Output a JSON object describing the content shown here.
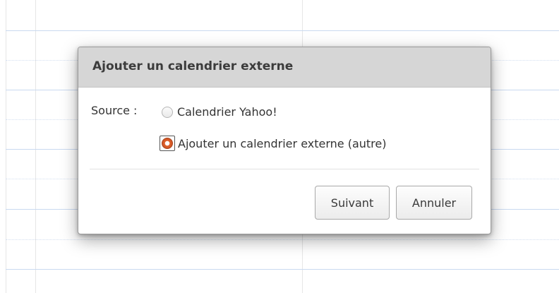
{
  "dialog": {
    "title": "Ajouter un calendrier externe",
    "source_label": "Source :",
    "options": [
      {
        "label": "Calendrier Yahoo!",
        "checked": false
      },
      {
        "label": "Ajouter un calendrier externe (autre)",
        "checked": true
      }
    ],
    "buttons": {
      "next_label": "Suivant",
      "cancel_label": "Annuler"
    }
  },
  "colors": {
    "radio_selected": "#e0632f",
    "header_background": "#d6d6d6",
    "grid_line": "#c9d9f0"
  }
}
